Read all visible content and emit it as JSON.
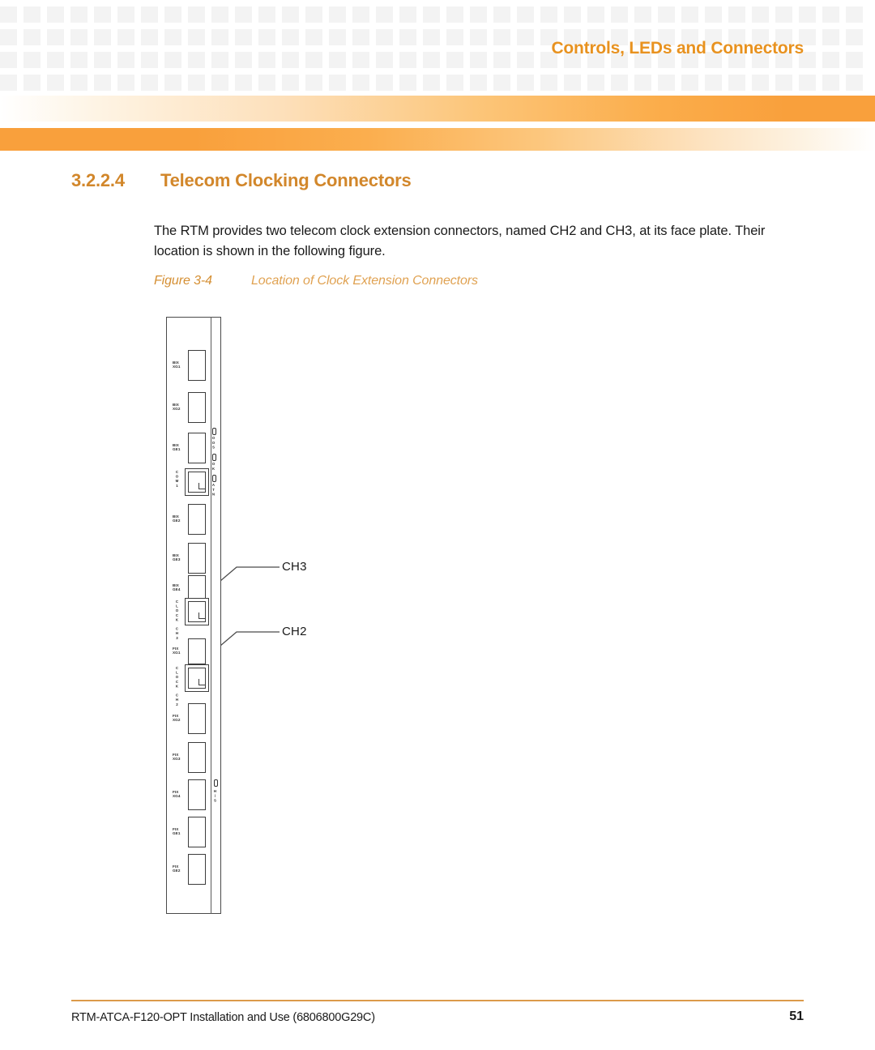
{
  "header": {
    "title": "Controls, LEDs and Connectors",
    "accent_color": "#f9a03c",
    "title_color": "#e8921f",
    "grid_cell_color": "#f3f3f3"
  },
  "section": {
    "number": "3.2.2.4",
    "title": "Telecom Clocking Connectors",
    "heading_color": "#d2872b",
    "body": "The RTM provides two telecom clock extension connectors, named CH2 and CH3, at its face plate. Their location is shown in the following figure."
  },
  "figure": {
    "label": "Figure 3-4",
    "title": "Location of Clock Extension Connectors",
    "caption_color": "#dfa04a",
    "faceplate": {
      "ports": [
        {
          "id": "bix-xg1",
          "line1": "BIX",
          "line2": "XG1",
          "type": "box"
        },
        {
          "id": "bix-xg2",
          "line1": "BIX",
          "line2": "XG2",
          "type": "box"
        },
        {
          "id": "bix-ge1",
          "line1": "BIX",
          "line2": "GE1",
          "type": "box"
        },
        {
          "id": "com1",
          "line1": "COM",
          "line2": "1",
          "type": "rj45",
          "vlabel": "COM1"
        },
        {
          "id": "bix-ge2",
          "line1": "BIX",
          "line2": "GE2",
          "type": "box"
        },
        {
          "id": "bix-ge3",
          "line1": "BIX",
          "line2": "GE3",
          "type": "box"
        },
        {
          "id": "bix-ge4",
          "line1": "BIX",
          "line2": "GE4",
          "type": "box"
        },
        {
          "id": "clock-ch3",
          "line1": "CLOCK",
          "line2": "CH3",
          "type": "rj45",
          "vlabel": "CLOCK CH3"
        },
        {
          "id": "fix-xg1",
          "line1": "FIX",
          "line2": "XG1",
          "type": "box"
        },
        {
          "id": "clock-ch2",
          "line1": "CLOCK",
          "line2": "CH2",
          "type": "rj45",
          "vlabel": "CLOCK CH2"
        },
        {
          "id": "fix-xg2",
          "line1": "FIX",
          "line2": "XG2",
          "type": "box"
        },
        {
          "id": "fix-xg3",
          "line1": "FIX",
          "line2": "XG3",
          "type": "box"
        },
        {
          "id": "fix-xg4",
          "line1": "FIX",
          "line2": "XG4",
          "type": "box"
        },
        {
          "id": "fix-ge1",
          "line1": "FIX",
          "line2": "GE1",
          "type": "box"
        },
        {
          "id": "fix-ge2",
          "line1": "FIX",
          "line2": "GE2",
          "type": "box"
        }
      ],
      "leds": [
        {
          "id": "led-oos",
          "label": "OOS"
        },
        {
          "id": "led-ok",
          "label": "OK"
        },
        {
          "id": "led-atn",
          "label": "ATN"
        },
        {
          "id": "led-hs",
          "label": "H/S"
        }
      ]
    },
    "callouts": [
      {
        "id": "callout-ch3",
        "label": "CH3"
      },
      {
        "id": "callout-ch2",
        "label": "CH2"
      }
    ]
  },
  "footer": {
    "document": "RTM-ATCA-F120-OPT Installation and Use (6806800G29C)",
    "page_number": "51",
    "rule_color": "#dc9a4a"
  }
}
